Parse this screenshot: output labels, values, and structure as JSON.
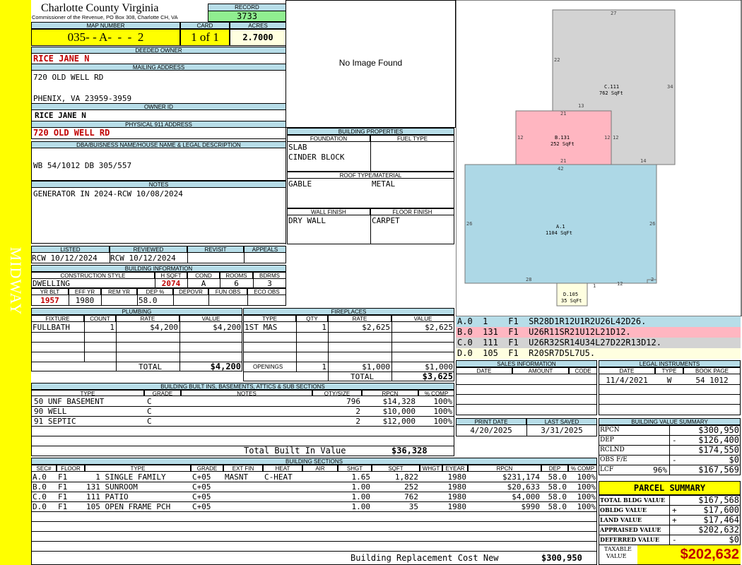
{
  "sidebar": {
    "label": "MIDWAY"
  },
  "header": {
    "county": "Charlotte County Virginia",
    "subtitle": "Commissioner of the Revenue, PO Box 308, Charlotte CH, VA",
    "record_label": "RECORD",
    "record": "3733",
    "map_label": "MAP NUMBER",
    "map": "035- - A-  -  -  2",
    "card_label": "CARD",
    "card": "1 of 1",
    "acres_label": "ACRES",
    "acres": "2.7000"
  },
  "owner": {
    "deeded_label": "DEEDED OWNER",
    "deeded": "RICE JANE N",
    "mailing_label": "MAILING ADDRESS",
    "mail1": "720 OLD WELL RD",
    "mail2": "PHENIX, VA 23959-3959",
    "owner_id_label": "OWNER ID",
    "owner_id": "RICE JANE N",
    "physical_label": "PHYSICAL 911 ADDRESS",
    "physical": "720 OLD WELL RD",
    "dba_label": "DBA/BUISNESS NAME/HOUSE NAME & LEGAL DESCRIPTION",
    "dba": "WB 54/1012 DB 305/557",
    "notes_label": "NOTES",
    "notes": "GENERATOR IN 2024-RCW 10/08/2024"
  },
  "photo": {
    "text": "No Image Found"
  },
  "building_props": {
    "title": "BUILDING PROPERTIES",
    "foundation_label": "FOUNDATION",
    "fuel_label": "FUEL TYPE",
    "foundation1": "SLAB",
    "foundation2": "CINDER BLOCK",
    "roof_label": "ROOF TYPE/MATERIAL",
    "roof_type": "GABLE",
    "roof_material": "METAL",
    "wall_label": "WALL FINISH",
    "floor_label": "FLOOR FINISH",
    "wall": "DRY WALL",
    "floor": "CARPET"
  },
  "review": {
    "listed_label": "LISTED",
    "reviewed_label": "REVIEWED",
    "revisit_label": "REVISIT",
    "appeals_label": "APPEALS",
    "listed": "RCW 10/12/2024",
    "reviewed": "RCW 10/12/2024"
  },
  "building_info": {
    "title": "BUILDING INFORMATION",
    "style_label": "CONSTRUCTION STYLE",
    "hsqft_label": "H SQFT",
    "cond_label": "COND",
    "rooms_label": "ROOMS",
    "bdrms_label": "BDRMS",
    "style": "DWELLING",
    "hsqft": "2074",
    "cond": "A",
    "rooms": "6",
    "bdrms": "3",
    "yrblt_label": "YR BLT",
    "effyr_label": "EFF YR",
    "remyr_label": "REM YR",
    "dep_label": "DEP %",
    "depovr_label": "DEPOVR",
    "funobs_label": "FUN OBS",
    "ecoobs_label": "ECO OBS",
    "yrblt": "1957",
    "effyr": "1980",
    "dep": "58.0"
  },
  "plumbing": {
    "title": "PLUMBING",
    "headers": [
      "FIXTURE",
      "COUNT",
      "RATE",
      "VALUE"
    ],
    "rows": [
      [
        "FULLBATH",
        "1",
        "$4,200",
        "$4,200"
      ]
    ],
    "total_label": "TOTAL",
    "total": "$4,200"
  },
  "fireplaces": {
    "title": "FIREPLACES",
    "headers": [
      "TYPE",
      "QTY",
      "RATE",
      "VALUE"
    ],
    "rows": [
      [
        "1ST MAS",
        "1",
        "$2,625",
        "$2,625"
      ]
    ],
    "openings_label": "OPENINGS",
    "openings_qty": "1",
    "openings_rate": "$1,000",
    "openings_value": "$1,000",
    "total_label": "TOTAL",
    "total": "$3,625"
  },
  "builtins": {
    "title": "BUILDING BUILT INS, BASEMENTS, ATTICS & SUB SECTIONS",
    "headers": [
      "TYPE",
      "GRADE",
      "NOTES",
      "QTY/SIZE",
      "RPCN",
      "% COMP"
    ],
    "rows": [
      [
        "50 UNF BASEMENT",
        "C",
        "",
        "796",
        "$14,328",
        "100%"
      ],
      [
        "90 WELL",
        "C",
        "",
        "2",
        "$10,000",
        "100%"
      ],
      [
        "91 SEPTIC",
        "C",
        "",
        "2",
        "$12,000",
        "100%"
      ]
    ],
    "total_label": "Total Built In Value",
    "total": "$36,328"
  },
  "sections": {
    "title": "BUILDING SECTIONS",
    "headers": [
      "SEC#",
      "FLOOR",
      "TYPE",
      "GRADE",
      "EXT FIN",
      "HEAT",
      "AIR",
      "SHGT",
      "SQFT",
      "WHGT",
      "EYEAR",
      "RPCN",
      "DEP",
      "% COMP"
    ],
    "rows": [
      [
        "A.0",
        "F1",
        "  1 SINGLE FAMILY",
        "C+05",
        "MASNT",
        "C-HEAT",
        "",
        "1.65",
        "1,822",
        "",
        "1980",
        "$231,174",
        "58.0",
        "100%"
      ],
      [
        "B.0",
        "F1",
        "131 SUNROOM",
        "C+05",
        "",
        "",
        "",
        "1.00",
        "252",
        "",
        "1980",
        "$20,633",
        "58.0",
        "100%"
      ],
      [
        "C.0",
        "F1",
        "111 PATIO",
        "C+05",
        "",
        "",
        "",
        "1.00",
        "762",
        "",
        "1980",
        "$4,000",
        "58.0",
        "100%"
      ],
      [
        "D.0",
        "F1",
        "105 OPEN FRAME PCH",
        "C+05",
        "",
        "",
        "",
        "1.00",
        "35",
        "",
        "1980",
        "$990",
        "58.0",
        "100%"
      ]
    ],
    "replacement_label": "Building Replacement Cost New",
    "replacement": "$300,950"
  },
  "sketch": {
    "c": {
      "code": "C.111",
      "area": "762 SqFt",
      "top": "27",
      "left": "22",
      "right": "34",
      "b1": "13",
      "b2": "14"
    },
    "b": {
      "code": "B.131",
      "area": "252 SqFt",
      "top": "21",
      "left": "12",
      "right": "12",
      "right2": "12",
      "bottom": "21"
    },
    "a": {
      "code": "A.1",
      "area": "1104 SqFt",
      "top": "42",
      "left": "26",
      "right": "26",
      "bottom": "28",
      "b2": "1",
      "b3": "12",
      "b4": "2"
    },
    "d": {
      "code": "D.105",
      "area": "35 SqFt"
    }
  },
  "vectors": [
    {
      "text": "A.0  1    F1  SR28D1R12U1R2U26L42D26.",
      "color": "#b7dde8"
    },
    {
      "text": "B.0  131  F1  U26R11SR21U12L21D12.",
      "color": "#ffb6c1"
    },
    {
      "text": "C.0  111  F1  U26R32SR14U34L27D22R13D12.",
      "color": "#d3d3d3"
    },
    {
      "text": "D.0  105  F1  R20SR7D5L7U5.",
      "color": "#ffffe0"
    }
  ],
  "sales": {
    "title": "SALES INFORMATION",
    "headers": [
      "DATE",
      "AMOUNT",
      "CODE"
    ]
  },
  "legal": {
    "title": "LEGAL INSTRUMENTS",
    "headers": [
      "DATE",
      "TYPE",
      "BOOK PAGE"
    ],
    "rows": [
      [
        "11/4/2021",
        "W",
        "54 1012"
      ]
    ]
  },
  "dates": {
    "print_label": "PRINT DATE",
    "saved_label": "LAST SAVED",
    "print": "4/20/2025",
    "saved": "3/31/2025"
  },
  "value_summary": {
    "title": "BUILDING VALUE SUMMARY",
    "rows": [
      {
        "label": "RPCN",
        "sign": "",
        "value": "$300,950"
      },
      {
        "label": "DEP",
        "sign": "-",
        "value": "$126,400"
      },
      {
        "label": "RCLND",
        "sign": "",
        "value": "$174,550"
      },
      {
        "label": "OBS F/E",
        "sign": "-",
        "value": "$0"
      },
      {
        "label": "LCF",
        "pct": "96%",
        "sign": "",
        "value": "$167,569"
      }
    ]
  },
  "parcel": {
    "title": "PARCEL SUMMARY",
    "rows": [
      {
        "label": "TOTAL BLDG VALUE",
        "sign": "",
        "value": "$167,568"
      },
      {
        "label": "OBLDG VALUE",
        "sign": "+",
        "value": "$17,600"
      },
      {
        "label": "LAND VALUE",
        "sign": "+",
        "value": "$17,464"
      },
      {
        "label": "APPRAISED VALUE",
        "sign": "",
        "value": "$202,632"
      },
      {
        "label": "DEFERRED VALUE",
        "sign": "-",
        "value": "$0"
      }
    ],
    "taxable_label1": "TAXABLE",
    "taxable_label2": "VALUE",
    "taxable": "$202,632"
  },
  "colors": {
    "yellow": "#ffff00",
    "header_blue": "#b7dde8",
    "record_green": "#90ee90",
    "red": "#c00000"
  }
}
